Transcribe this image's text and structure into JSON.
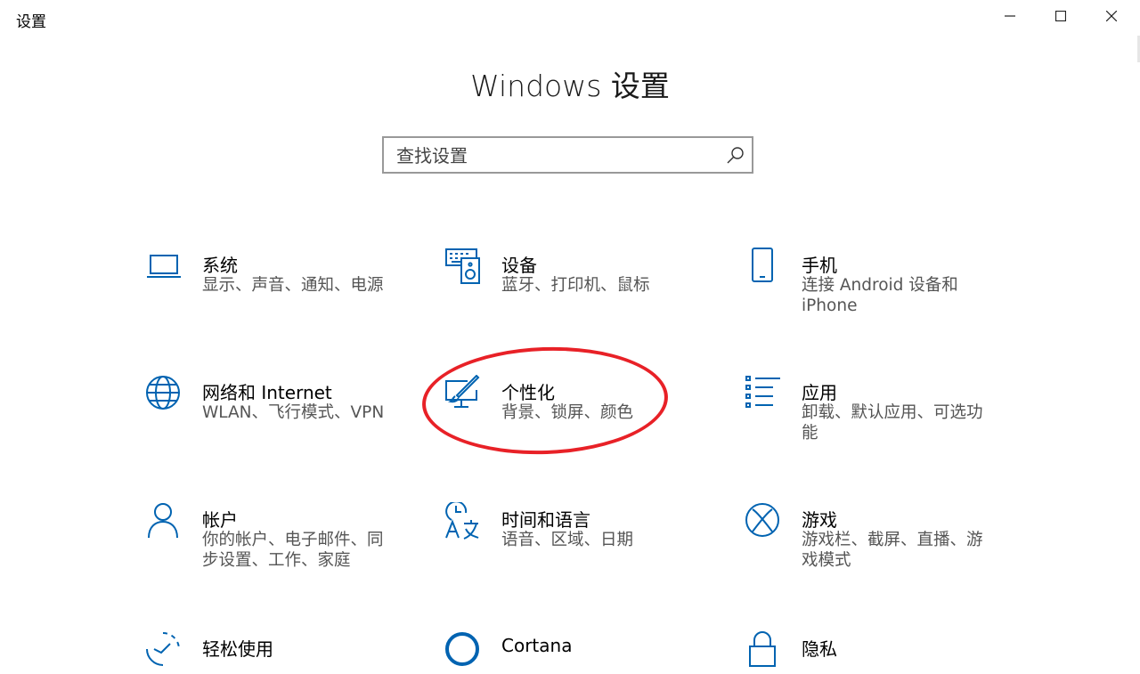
{
  "window": {
    "title": "设置"
  },
  "page": {
    "title": "Windows 设置"
  },
  "search": {
    "placeholder": "查找设置"
  },
  "tiles": [
    {
      "icon": "laptop-icon",
      "title": "系统",
      "desc": "显示、声音、通知、电源"
    },
    {
      "icon": "keyboard-speaker-icon",
      "title": "设备",
      "desc": "蓝牙、打印机、鼠标"
    },
    {
      "icon": "phone-icon",
      "title": "手机",
      "desc": "连接 Android 设备和 iPhone"
    },
    {
      "icon": "globe-icon",
      "title": "网络和 Internet",
      "desc": "WLAN、飞行模式、VPN"
    },
    {
      "icon": "paintbrush-monitor-icon",
      "title": "个性化",
      "desc": "背景、锁屏、颜色"
    },
    {
      "icon": "app-list-icon",
      "title": "应用",
      "desc": "卸载、默认应用、可选功能"
    },
    {
      "icon": "person-icon",
      "title": "帐户",
      "desc": "你的帐户、电子邮件、同步设置、工作、家庭"
    },
    {
      "icon": "time-language-icon",
      "title": "时间和语言",
      "desc": "语音、区域、日期"
    },
    {
      "icon": "xbox-icon",
      "title": "游戏",
      "desc": "游戏栏、截屏、直播、游戏模式"
    },
    {
      "icon": "ease-of-access-icon",
      "title": "轻松使用",
      "desc": ""
    },
    {
      "icon": "cortana-icon",
      "title": "Cortana",
      "desc": ""
    },
    {
      "icon": "lock-icon",
      "title": "隐私",
      "desc": ""
    }
  ],
  "annotation": {
    "color": "#e82127"
  },
  "colors": {
    "accent": "#0063b1"
  }
}
